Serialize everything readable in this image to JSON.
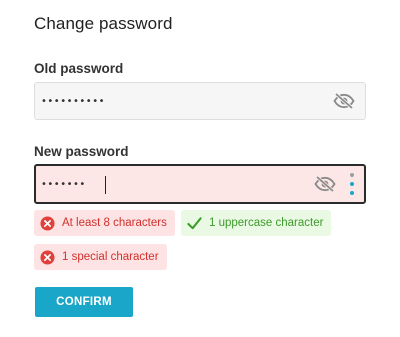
{
  "form": {
    "title": "Change password",
    "old_password": {
      "label": "Old password",
      "value": "••••••••••",
      "toggle_icon": "eye-slash-icon"
    },
    "new_password": {
      "label": "New password",
      "value": "•••••••",
      "toggle_icon": "eye-slash-icon",
      "strength_icon": "vertical-dots-icon",
      "strength_colors": [
        "#9e9e9e",
        "#1aa6c8",
        "#1aa6c8"
      ],
      "border_color": "#2a2a2a",
      "background": "#fde6e6"
    },
    "requirements": [
      {
        "text": "At least 8 characters",
        "status": "unmet",
        "icon": "x-circle-icon"
      },
      {
        "text": "1 uppercase character",
        "status": "met",
        "icon": "checkmark-icon"
      },
      {
        "text": "1 special character",
        "status": "unmet",
        "icon": "x-circle-icon"
      }
    ],
    "confirm_label": "CONFIRM"
  },
  "colors": {
    "accent": "#1aa6c8",
    "error": "#d0312d",
    "error_bg": "#fde3e3",
    "success": "#3d9b2b",
    "success_bg": "#eaf9e3"
  }
}
